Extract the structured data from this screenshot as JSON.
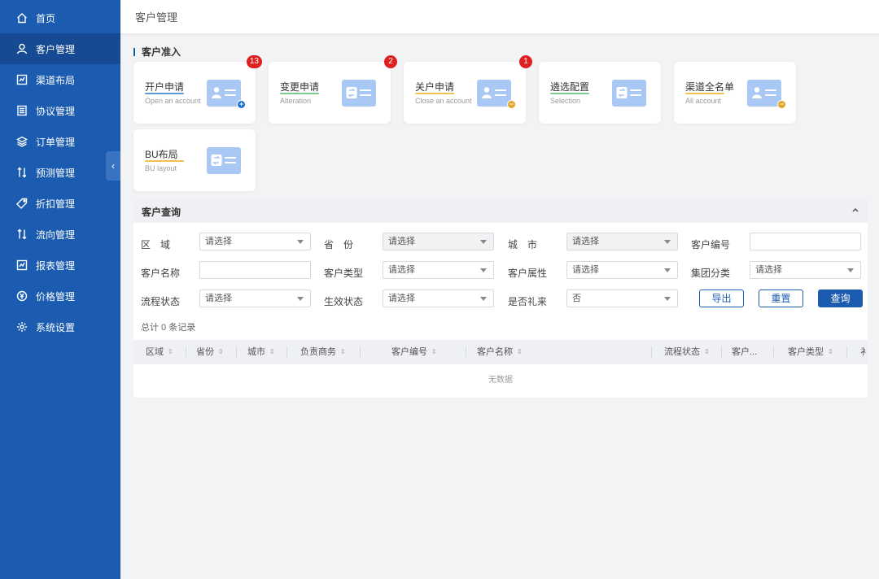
{
  "sidebar": {
    "items": [
      {
        "label": "首页",
        "icon": "home-icon"
      },
      {
        "label": "客户管理",
        "icon": "user-icon"
      },
      {
        "label": "渠道布局",
        "icon": "layout-icon"
      },
      {
        "label": "协议管理",
        "icon": "document-icon"
      },
      {
        "label": "订单管理",
        "icon": "layers-icon"
      },
      {
        "label": "预测管理",
        "icon": "forecast-icon"
      },
      {
        "label": "折扣管理",
        "icon": "tag-icon"
      },
      {
        "label": "流向管理",
        "icon": "flow-icon"
      },
      {
        "label": "报表管理",
        "icon": "chart-icon"
      },
      {
        "label": "价格管理",
        "icon": "yen-icon"
      },
      {
        "label": "系统设置",
        "icon": "gear-icon"
      }
    ],
    "active_index": 1,
    "collapse_glyph": "‹"
  },
  "header": {
    "title": "客户管理"
  },
  "admission": {
    "section_title": "客户准入",
    "cards": [
      {
        "title": "开户申请",
        "subtitle": "Open an account",
        "badge": "13",
        "accent": "#5b9bd5",
        "icon": "person-card-icon",
        "mini": "+"
      },
      {
        "title": "变更申请",
        "subtitle": "Alteration",
        "badge": "2",
        "accent": "#7ec98f",
        "icon": "swap-card-icon",
        "mini": ""
      },
      {
        "title": "关户申请",
        "subtitle": "Close an account",
        "badge": "1",
        "accent": "#f2c14e",
        "icon": "person-card-icon",
        "mini": "−"
      },
      {
        "title": "遴选配置",
        "subtitle": "Selection",
        "badge": "",
        "accent": "#7ec98f",
        "icon": "swap-card-icon",
        "mini": ""
      },
      {
        "title": "渠道全名单",
        "subtitle": "All account",
        "badge": "",
        "accent": "#f2c14e",
        "icon": "person-card-icon",
        "mini": "−"
      },
      {
        "title": "BU布局",
        "subtitle": "BU layout",
        "badge": "",
        "accent": "#f2c14e",
        "icon": "swap-card-icon",
        "mini": ""
      }
    ]
  },
  "query": {
    "title": "客户查询",
    "fields": {
      "region": {
        "label": "区　域",
        "value": "请选择"
      },
      "province": {
        "label": "省　份",
        "value": "请选择"
      },
      "city": {
        "label": "城　市",
        "value": "请选择"
      },
      "customer_no": {
        "label": "客户编号",
        "value": ""
      },
      "customer_name": {
        "label": "客户名称",
        "value": ""
      },
      "customer_type": {
        "label": "客户类型",
        "value": "请选择"
      },
      "customer_attr": {
        "label": "客户属性",
        "value": "请选择"
      },
      "group_class": {
        "label": "集团分类",
        "value": "请选择"
      },
      "flow_status": {
        "label": "流程状态",
        "value": "请选择"
      },
      "effective_status": {
        "label": "生效状态",
        "value": "请选择"
      },
      "gift": {
        "label": "是否礼来",
        "value": "否"
      }
    },
    "buttons": {
      "export": "导出",
      "reset": "重置",
      "search": "查询"
    },
    "total": "总计 0 条记录",
    "columns": [
      "区域",
      "省份",
      "城市",
      "负责商务",
      "客户编号",
      "客户名称",
      "流程状态",
      "客户...",
      "客户类型",
      "衤"
    ],
    "empty_text": "无数据",
    "sort_glyph": "⇕"
  },
  "colors": {
    "brand": "#1b5bb0",
    "badge": "#e02020",
    "card_icon": "#a9c8f3"
  }
}
